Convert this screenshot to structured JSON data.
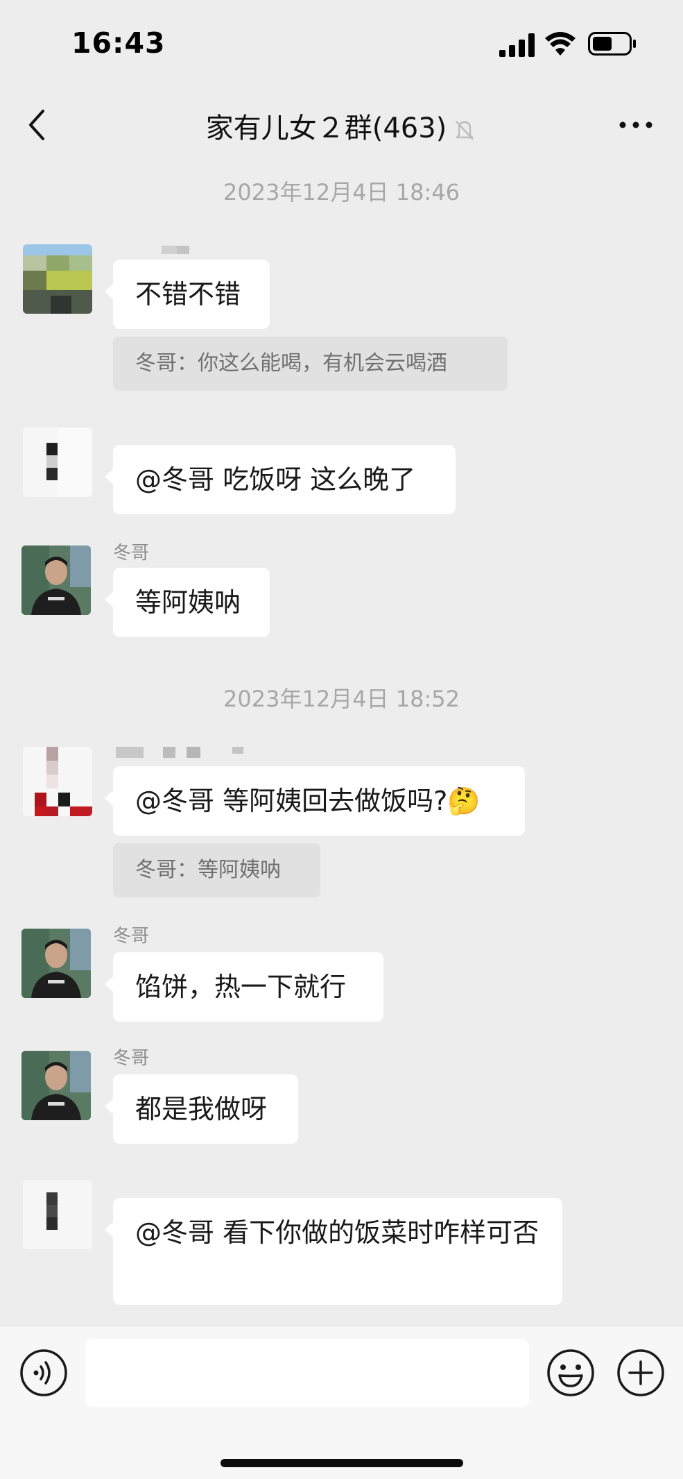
{
  "status": {
    "time": "16:43"
  },
  "nav": {
    "title": "家有儿女２群(463)"
  },
  "timestamps": [
    "2023年12月4日 18:46",
    "2023年12月4日 18:52"
  ],
  "messages": [
    {
      "text": "不错不错",
      "quote": "冬哥：你这么能喝，有机会云喝酒"
    },
    {
      "text": "@冬哥 吃饭呀 这么晚了"
    },
    {
      "sender": "冬哥",
      "text": "等阿姨呐"
    },
    {
      "text": "@冬哥 等阿姨回去做饭吗?",
      "emoji": "🤔",
      "quote": "冬哥：等阿姨呐"
    },
    {
      "sender": "冬哥",
      "text": "馅饼，热一下就行"
    },
    {
      "sender": "冬哥",
      "text": "都是我做呀"
    },
    {
      "text": "@冬哥 看下你做的饭菜时咋样可否"
    }
  ],
  "input": {
    "value": ""
  }
}
